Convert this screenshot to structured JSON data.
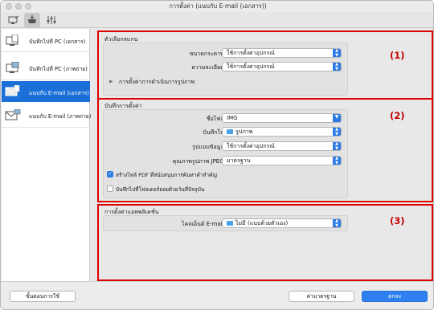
{
  "window": {
    "title": "การตั้งค่า (แนบกับ E-mail (เอกสาร))"
  },
  "toolbar": {
    "tabs": [
      {
        "icon": "scan-from-computer-icon"
      },
      {
        "icon": "scan-from-operation-panel-icon"
      },
      {
        "icon": "general-settings-icon"
      }
    ]
  },
  "sidebar": {
    "items": [
      {
        "label": "บันทึกไปที่ PC (เอกสาร)",
        "icon": "save-to-pc-document-icon",
        "selected": false
      },
      {
        "label": "บันทึกไปที่ PC (ภาพถ่าย)",
        "icon": "save-to-pc-photo-icon",
        "selected": false
      },
      {
        "label": "แนบกับ E-mail (เอกสาร)",
        "icon": "email-document-icon",
        "selected": true
      },
      {
        "label": "แนบกับ E-mail (ภาพถ่าย)",
        "icon": "email-photo-icon",
        "selected": false
      }
    ]
  },
  "scan_options": {
    "title": "ตัวเลือกสแกน",
    "paper_size_label": "ขนาดกระดาษ:",
    "paper_size_value": "ใช้การตั้งค่าอุปกรณ์",
    "resolution_label": "ความละเอียด:",
    "resolution_value": "ใช้การตั้งค่าอุปกรณ์",
    "image_processing_label": "การตั้งค่าการดำเนินการรูปภาพ",
    "marker": "(1)"
  },
  "save_settings": {
    "title": "บันทึกการตั้งค่า",
    "file_name_label": "ชื่อไฟล์:",
    "file_name_value": "IMG",
    "save_in_label": "บันทึกใน:",
    "save_in_value": "รูปภาพ",
    "data_format_label": "รูปแบบข้อมูล:",
    "data_format_value": "ใช้การตั้งค่าอุปกรณ์",
    "jpeg_quality_label": "คุณภาพรูปภาพ JPEG:",
    "jpeg_quality_value": "มาตรฐาน",
    "searchable_pdf_label": "สร้างไฟล์ PDF ที่สนับสนุนการค้นหาคำสำคัญ",
    "searchable_pdf_checked": true,
    "subfolder_label": "บันทึกไปที่โฟลเดอร์ย่อยด้วยวันที่ปัจจุบัน",
    "subfolder_checked": false,
    "marker": "(2)"
  },
  "app_settings": {
    "title": "การตั้งค่าแอพพลิเคชั่น",
    "email_client_label": "ไคลเอ็นต์ E-mail:",
    "email_client_value": "ไม่มี (แนบด้วยตัวเอง)",
    "marker": "(3)"
  },
  "footer": {
    "instructions_label": "ขั้นตอนการใช้",
    "defaults_label": "ค่ามาตรฐาน",
    "ok_label": "ตกลง"
  },
  "colors": {
    "accent": "#2e7ff0",
    "selection": "#1a6fd8",
    "highlight_box": "#e00000"
  }
}
